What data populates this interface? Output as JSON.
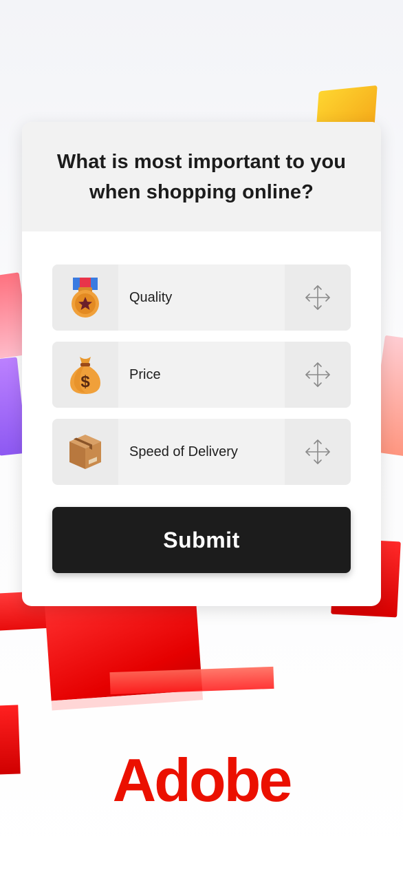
{
  "survey": {
    "question": "What is most important to you when shopping online?",
    "options": [
      {
        "label": "Quality",
        "icon": "medal-icon"
      },
      {
        "label": "Price",
        "icon": "money-bag-icon"
      },
      {
        "label": "Speed of Delivery",
        "icon": "package-box-icon"
      }
    ],
    "drag_handle_icon": "move-arrows-icon",
    "submit_label": "Submit"
  },
  "brand": {
    "logo_text": "Adobe",
    "color": "#eb1000"
  },
  "colors": {
    "card_header_bg": "#f2f2f2",
    "option_bg": "#f2f2f2",
    "button_bg": "#1c1c1c"
  }
}
